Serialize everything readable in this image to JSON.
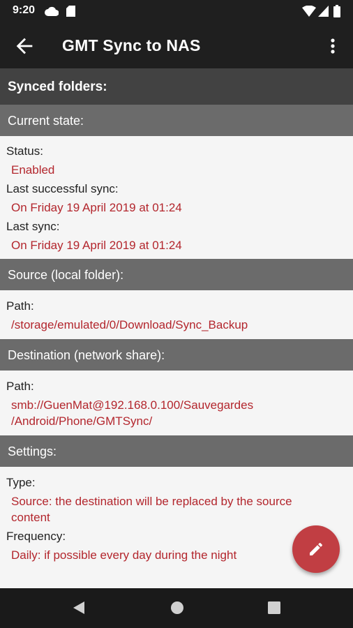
{
  "status_bar": {
    "time": "9:20",
    "icons": [
      "cloud-icon",
      "sd-card-icon",
      "wifi-icon",
      "signal-icon",
      "battery-icon"
    ]
  },
  "app_bar": {
    "title": "GMT Sync to NAS",
    "back_icon": "arrow-back-icon",
    "menu_icon": "more-vert-icon"
  },
  "page": {
    "header": "Synced folders:"
  },
  "current_state": {
    "header": "Current state:",
    "status_label": "Status:",
    "status_value": "Enabled",
    "last_successful_label": "Last successful sync:",
    "last_successful_value": "On Friday 19 April 2019 at 01:24",
    "last_sync_label": "Last sync:",
    "last_sync_value": "On Friday 19 April 2019 at 01:24"
  },
  "source": {
    "header": "Source (local folder):",
    "path_label": "Path:",
    "path_value": "/storage/emulated/0/Download/Sync_Backup"
  },
  "destination": {
    "header": "Destination (network share):",
    "path_label": "Path:",
    "path_line1": "smb://GuenMat@192.168.0.100/Sauvegardes",
    "path_line2": "/Android/Phone/GMTSync/"
  },
  "settings": {
    "header": "Settings:",
    "type_label": "Type:",
    "type_line1": "Source: the destination will be replaced by the source",
    "type_line2": "content",
    "frequency_label": "Frequency:",
    "frequency_value": "Daily: if possible every day during the night"
  },
  "fab": {
    "icon": "edit-pencil-icon"
  },
  "nav_bar": {
    "icons": [
      "nav-back-icon",
      "nav-home-icon",
      "nav-recents-icon"
    ]
  },
  "colors": {
    "app_bar": "#1f1f1f",
    "page_header": "#424242",
    "section_header": "#6b6b6b",
    "value_text": "#b3262d",
    "fab": "#c13e43",
    "background": "#f5f5f5"
  }
}
